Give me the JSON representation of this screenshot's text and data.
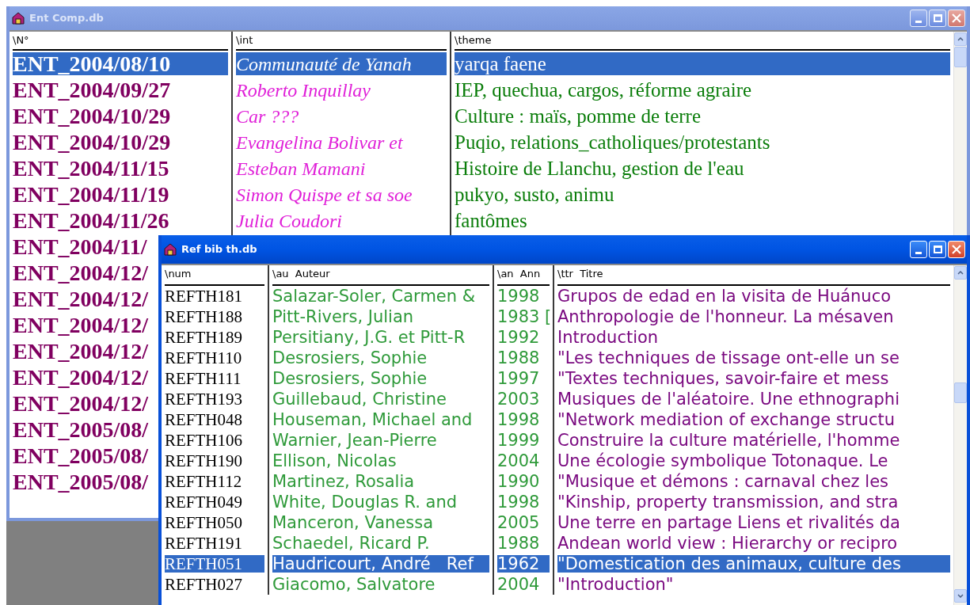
{
  "windows": [
    {
      "title": "Ent Comp.db",
      "active": false,
      "columns": [
        "\\N°",
        "\\int",
        "\\theme"
      ],
      "rows": [
        {
          "selected": true,
          "cells": [
            "ENT_2004/08/10",
            "Communauté de Yanah",
            "yarqa faene"
          ]
        },
        {
          "selected": false,
          "cells": [
            "ENT_2004/09/27",
            "Roberto Inquillay",
            "IEP, quechua, cargos, réforme agraire"
          ]
        },
        {
          "selected": false,
          "cells": [
            "ENT_2004/10/29",
            "Car ???",
            "Culture : maïs, pomme de terre"
          ]
        },
        {
          "selected": false,
          "cells": [
            "ENT_2004/10/29",
            "Evangelina Bolivar et",
            "Puqio, relations_catholiques/protestants"
          ]
        },
        {
          "selected": false,
          "cells": [
            "ENT_2004/11/15",
            "Esteban Mamani",
            "Histoire de Llanchu, gestion de l'eau"
          ]
        },
        {
          "selected": false,
          "cells": [
            "ENT_2004/11/19",
            "Simon Quispe et sa soe",
            "pukyo, susto, animu"
          ]
        },
        {
          "selected": false,
          "cells": [
            "ENT_2004/11/26",
            "Julia Coudori",
            "fantômes"
          ]
        },
        {
          "selected": false,
          "cells": [
            "ENT_2004/11/"
          ]
        },
        {
          "selected": false,
          "cells": [
            "ENT_2004/12/"
          ]
        },
        {
          "selected": false,
          "cells": [
            "ENT_2004/12/"
          ]
        },
        {
          "selected": false,
          "cells": [
            "ENT_2004/12/"
          ]
        },
        {
          "selected": false,
          "cells": [
            "ENT_2004/12/"
          ]
        },
        {
          "selected": false,
          "cells": [
            "ENT_2004/12/"
          ]
        },
        {
          "selected": false,
          "cells": [
            "ENT_2004/12/"
          ]
        },
        {
          "selected": false,
          "cells": [
            "ENT_2005/08/"
          ]
        },
        {
          "selected": false,
          "cells": [
            "ENT_2005/08/"
          ]
        },
        {
          "selected": false,
          "cells": [
            "ENT_2005/08/"
          ]
        }
      ]
    },
    {
      "title": "Ref bib th.db",
      "active": true,
      "columns": [
        "\\num",
        "\\au  Auteur",
        "\\an  Ann",
        "\\ttr  Titre"
      ],
      "rows": [
        {
          "selected": false,
          "cells": [
            "REFTH181",
            "Salazar-Soler, Carmen &",
            "1998",
            "Grupos de edad en la visita de Huánuco"
          ]
        },
        {
          "selected": false,
          "cells": [
            "REFTH188",
            "Pitt-Rivers, Julian",
            "1983 [",
            "Anthropologie de l'honneur. La mésaven"
          ]
        },
        {
          "selected": false,
          "cells": [
            "REFTH189",
            "Persitiany, J.G. et Pitt-R",
            "1992",
            "Introduction"
          ]
        },
        {
          "selected": false,
          "cells": [
            "REFTH110",
            "Desrosiers, Sophie",
            "1988",
            "\"Les techniques de tissage ont-elle un se"
          ]
        },
        {
          "selected": false,
          "cells": [
            "REFTH111",
            "Desrosiers, Sophie",
            "1997",
            "\"Textes techniques, savoir-faire et mess"
          ]
        },
        {
          "selected": false,
          "cells": [
            "REFTH193",
            "Guillebaud, Christine",
            "2003",
            "Musiques de l'aléatoire. Une ethnographi"
          ]
        },
        {
          "selected": false,
          "cells": [
            "REFTH048",
            "Houseman, Michael and",
            "1998",
            "\"Network mediation of exchange structu"
          ]
        },
        {
          "selected": false,
          "cells": [
            "REFTH106",
            "Warnier, Jean-Pierre",
            "1999",
            "Construire la culture matérielle, l'homme"
          ]
        },
        {
          "selected": false,
          "cells": [
            "REFTH190",
            "Ellison, Nicolas",
            "2004",
            "Une écologie symbolique Totonaque. Le"
          ]
        },
        {
          "selected": false,
          "cells": [
            "REFTH112",
            "Martinez, Rosalia",
            "1990",
            "\"Musique et démons : carnaval chez les"
          ]
        },
        {
          "selected": false,
          "cells": [
            "REFTH049",
            "White, Douglas R. and",
            "1998",
            "\"Kinship, property transmission, and stra"
          ]
        },
        {
          "selected": false,
          "cells": [
            "REFTH050",
            "Manceron, Vanessa",
            "2005",
            "Une terre en partage Liens et rivalités da"
          ]
        },
        {
          "selected": false,
          "cells": [
            "REFTH191",
            "Schaedel, Ricard P.",
            "1988",
            "Andean world view : Hierarchy or recipro"
          ]
        },
        {
          "selected": true,
          "cells": [
            "REFTH051",
            "Haudricourt, André   Ref",
            "1962",
            "\"Domestication des animaux, culture des"
          ]
        },
        {
          "selected": false,
          "cells": [
            "REFTH027",
            "Giacomo, Salvatore",
            "2004",
            "\"Introduction\""
          ]
        }
      ]
    }
  ]
}
